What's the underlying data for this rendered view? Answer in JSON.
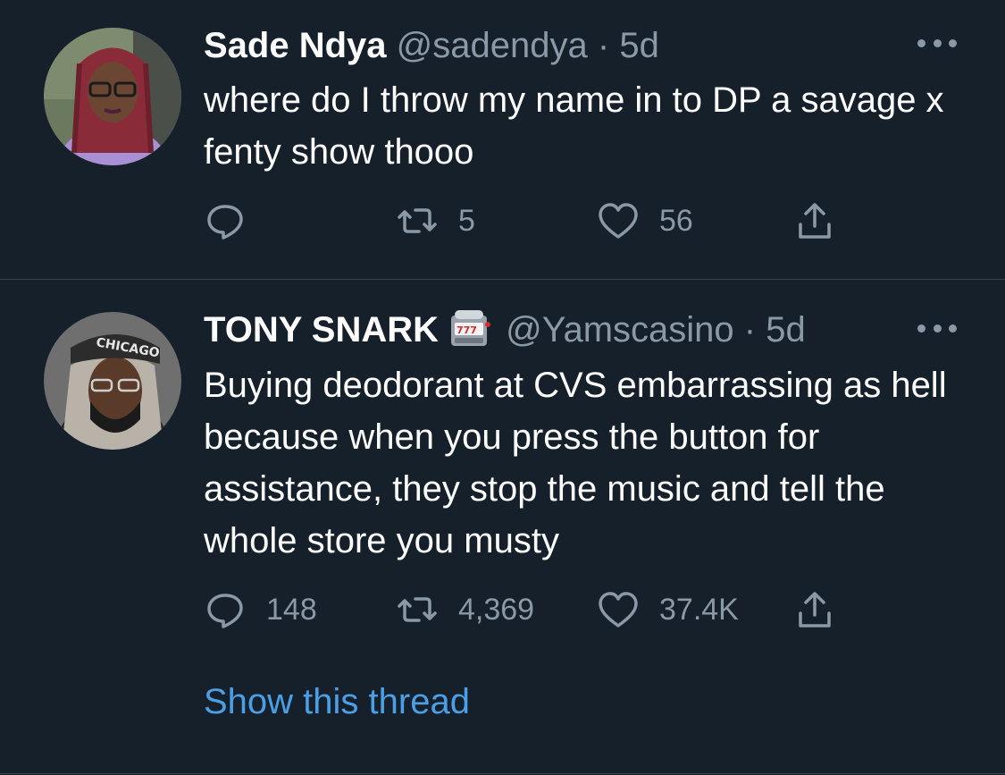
{
  "tweets": [
    {
      "name": "Sade Ndya",
      "handle": "@sadendya",
      "separator": "·",
      "time": "5d",
      "text": "where do I throw my name in to DP a savage x fenty show thooo",
      "reply_count": "",
      "retweet_count": "5",
      "like_count": "56"
    },
    {
      "name": "TONY SNARK",
      "name_emoji": "slot-machine-emoji",
      "handle": "@Yamscasino",
      "separator": "·",
      "time": "5d",
      "text": "Buying deodorant at CVS embarrassing as hell because when you press the button for assistance, they stop the music and tell the whole store you musty",
      "reply_count": "148",
      "retweet_count": "4,369",
      "like_count": "37.4K",
      "show_thread": "Show this thread"
    }
  ],
  "colors": {
    "background": "#15202b",
    "divider": "#38444d",
    "secondary_text": "#8b98a5",
    "link": "#4a9fe6"
  },
  "icons": [
    "reply-icon",
    "retweet-icon",
    "like-icon",
    "share-icon",
    "more-icon"
  ]
}
